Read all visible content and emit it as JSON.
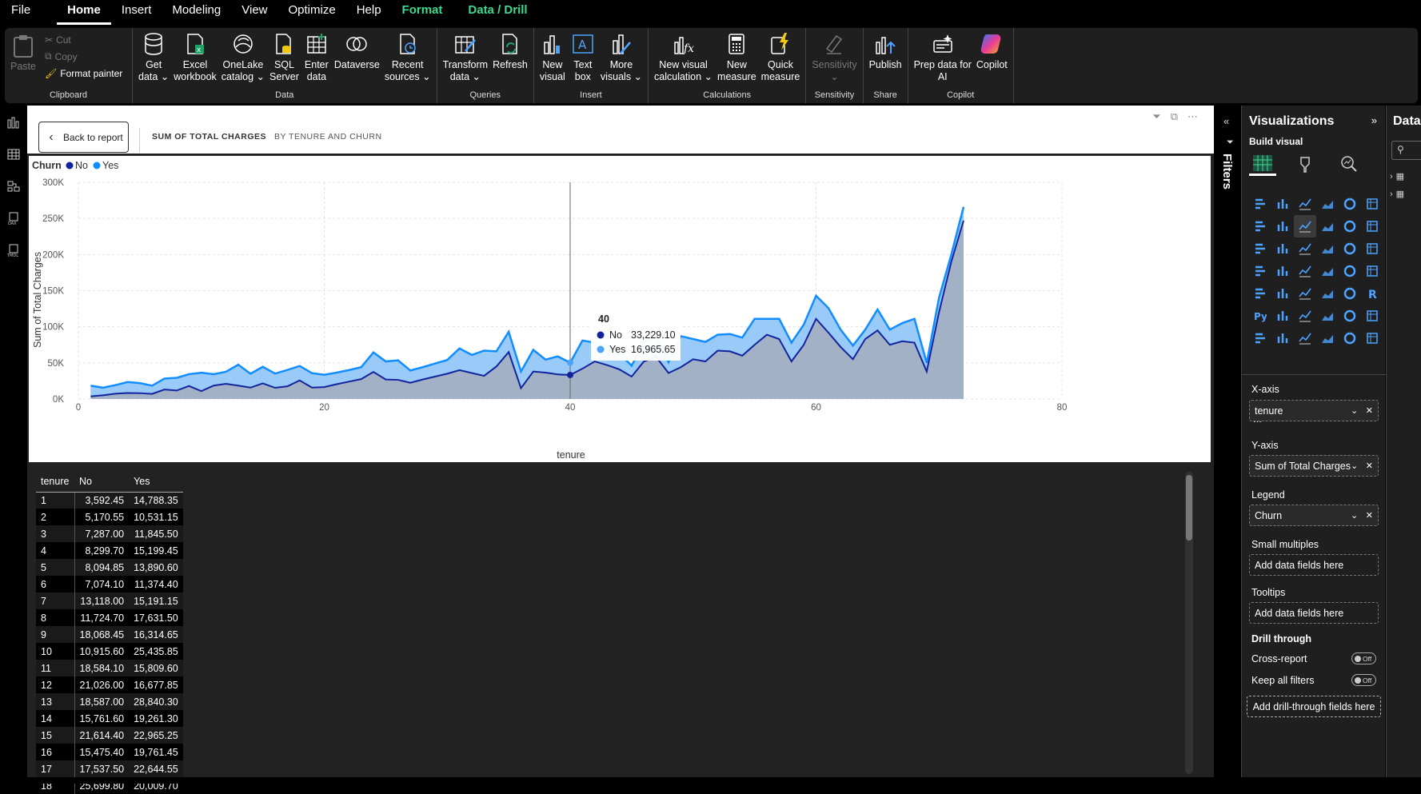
{
  "menu": {
    "items": [
      "File",
      "Home",
      "Insert",
      "Modeling",
      "View",
      "Optimize",
      "Help",
      "Format",
      "Data / Drill"
    ],
    "active": "Home"
  },
  "ribbon": {
    "clipboard": {
      "paste": "Paste",
      "cut": "Cut",
      "copy": "Copy",
      "format_painter": "Format painter",
      "label": "Clipboard"
    },
    "data": {
      "label": "Data",
      "buttons": [
        "Get\ndata ⌄",
        "Excel\nworkbook",
        "OneLake\ncatalog ⌄",
        "SQL\nServer",
        "Enter\ndata",
        "Dataverse",
        "Recent\nsources ⌄"
      ]
    },
    "queries": {
      "label": "Queries",
      "buttons": [
        "Transform\ndata ⌄",
        "Refresh"
      ]
    },
    "insert": {
      "label": "Insert",
      "buttons": [
        "New\nvisual",
        "Text\nbox",
        "More\nvisuals ⌄"
      ]
    },
    "calculations": {
      "label": "Calculations",
      "buttons": [
        "New visual\ncalculation ⌄",
        "New\nmeasure",
        "Quick\nmeasure"
      ]
    },
    "sensitivity": {
      "label": "Sensitivity",
      "buttons": [
        "Sensitivity\n⌄"
      ]
    },
    "share": {
      "label": "Share",
      "buttons": [
        "Publish"
      ]
    },
    "copilot": {
      "label": "Copilot",
      "buttons": [
        "Prep data for\nAI",
        "Copilot"
      ]
    }
  },
  "drill": {
    "back_label": "Back to report",
    "crumb_main": "SUM OF TOTAL CHARGES",
    "crumb_sub": "BY TENURE AND CHURN"
  },
  "legend": {
    "title": "Churn",
    "no": "No",
    "yes": "Yes"
  },
  "tooltip": {
    "x": "40",
    "no_label": "No",
    "no_value": "33,229.10",
    "yes_label": "Yes",
    "yes_value": "16,965.65"
  },
  "chart_data": {
    "type": "area",
    "title": "",
    "xlabel": "tenure",
    "ylabel": "Sum of Total Charges",
    "xlim": [
      0,
      80
    ],
    "ylim": [
      0,
      300000
    ],
    "x_ticks": [
      "0",
      "20",
      "40",
      "60",
      "80"
    ],
    "y_ticks": [
      "0K",
      "50K",
      "100K",
      "150K",
      "200K",
      "250K",
      "300K"
    ],
    "stacked": true,
    "x": [
      1,
      2,
      3,
      4,
      5,
      6,
      7,
      8,
      9,
      10,
      11,
      12,
      13,
      14,
      15,
      16,
      17,
      18,
      19,
      20,
      21,
      22,
      23,
      24,
      25,
      26,
      27,
      28,
      29,
      30,
      31,
      32,
      33,
      34,
      35,
      36,
      37,
      38,
      39,
      40,
      41,
      42,
      43,
      44,
      45,
      46,
      47,
      48,
      49,
      50,
      51,
      52,
      53,
      54,
      55,
      56,
      57,
      58,
      59,
      60,
      61,
      62,
      63,
      64,
      65,
      66,
      67,
      68,
      69,
      70,
      71,
      72
    ],
    "series": [
      {
        "name": "No",
        "color": "#12239e",
        "values": [
          3592.45,
          5170.55,
          7287.0,
          8299.7,
          8094.85,
          7074.1,
          13118.0,
          11724.7,
          18068.45,
          10915.6,
          18584.1,
          21026.0,
          18587.0,
          15761.6,
          21614.4,
          15475.4,
          17537.5,
          25699.8,
          15800,
          16500,
          20500,
          24000,
          27500,
          37500,
          27000,
          26500,
          22500,
          27000,
          31000,
          35000,
          40000,
          36000,
          32000,
          45000,
          65000,
          15000,
          38000,
          36500,
          34000,
          33229.1,
          42000,
          52000,
          47000,
          41000,
          31000,
          52000,
          58000,
          36000,
          44000,
          55000,
          52000,
          67000,
          66000,
          60000,
          75000,
          89000,
          83000,
          52000,
          75000,
          111000,
          92000,
          72000,
          55000,
          83000,
          95000,
          75000,
          80000,
          78000,
          38000,
          120000,
          190000,
          247000
        ]
      },
      {
        "name": "Yes",
        "color": "#4da3ff",
        "values": [
          14788.35,
          10531.15,
          11845.5,
          15199.45,
          13890.6,
          11374.4,
          15191.15,
          17631.5,
          16314.65,
          25435.85,
          15809.6,
          16677.85,
          28840.3,
          19261.3,
          22965.25,
          19761.45,
          22644.55,
          20009.7,
          20000,
          17000,
          16000,
          16000,
          16500,
          27000,
          25000,
          27000,
          17000,
          17000,
          18000,
          19000,
          30000,
          25000,
          35000,
          21000,
          28000,
          23000,
          30000,
          18000,
          25000,
          16965.65,
          39000,
          26000,
          27000,
          22000,
          15000,
          27000,
          29000,
          15000,
          43000,
          28000,
          27000,
          22000,
          24000,
          25000,
          36000,
          22000,
          28000,
          26000,
          28000,
          32000,
          34000,
          24000,
          19000,
          13000,
          29000,
          21000,
          25000,
          33000,
          12000,
          20000,
          10000,
          19000
        ]
      }
    ],
    "hover_x": 40,
    "legend": "top-left"
  },
  "table": {
    "columns": [
      "tenure",
      "No",
      "Yes"
    ],
    "rows": [
      [
        "1",
        "3,592.45",
        "14,788.35"
      ],
      [
        "2",
        "5,170.55",
        "10,531.15"
      ],
      [
        "3",
        "7,287.00",
        "11,845.50"
      ],
      [
        "4",
        "8,299.70",
        "15,199.45"
      ],
      [
        "5",
        "8,094.85",
        "13,890.60"
      ],
      [
        "6",
        "7,074.10",
        "11,374.40"
      ],
      [
        "7",
        "13,118.00",
        "15,191.15"
      ],
      [
        "8",
        "11,724.70",
        "17,631.50"
      ],
      [
        "9",
        "18,068.45",
        "16,314.65"
      ],
      [
        "10",
        "10,915.60",
        "25,435.85"
      ],
      [
        "11",
        "18,584.10",
        "15,809.60"
      ],
      [
        "12",
        "21,026.00",
        "16,677.85"
      ],
      [
        "13",
        "18,587.00",
        "28,840.30"
      ],
      [
        "14",
        "15,761.60",
        "19,261.30"
      ],
      [
        "15",
        "21,614.40",
        "22,965.25"
      ],
      [
        "16",
        "15,475.40",
        "19,761.45"
      ],
      [
        "17",
        "17,537.50",
        "22,644.55"
      ],
      [
        "18",
        "25,699.80",
        "20,009.70"
      ]
    ]
  },
  "filters": {
    "label": "Filters"
  },
  "viz": {
    "title": "Visualizations",
    "build_label": "Build visual",
    "more": "...",
    "x_axis_label": "X-axis",
    "x_axis_value": "tenure",
    "y_axis_label": "Y-axis",
    "y_axis_value": "Sum of Total Charges",
    "legend_label": "Legend",
    "legend_value": "Churn",
    "small_multiples_label": "Small multiples",
    "small_multiples_placeholder": "Add data fields here",
    "tooltips_label": "Tooltips",
    "tooltips_placeholder": "Add data fields here",
    "drill_label": "Drill through",
    "cross_report": "Cross-report",
    "keep_filters": "Keep all filters",
    "toggle_off": "Off",
    "drill_placeholder": "Add drill-through fields here"
  },
  "data_pane": {
    "title": "Data"
  },
  "colors": {
    "no": "#12239e",
    "yes": "#118dff",
    "no_fill": "#a3b1c7",
    "yes_fill": "#8fc4f7"
  }
}
